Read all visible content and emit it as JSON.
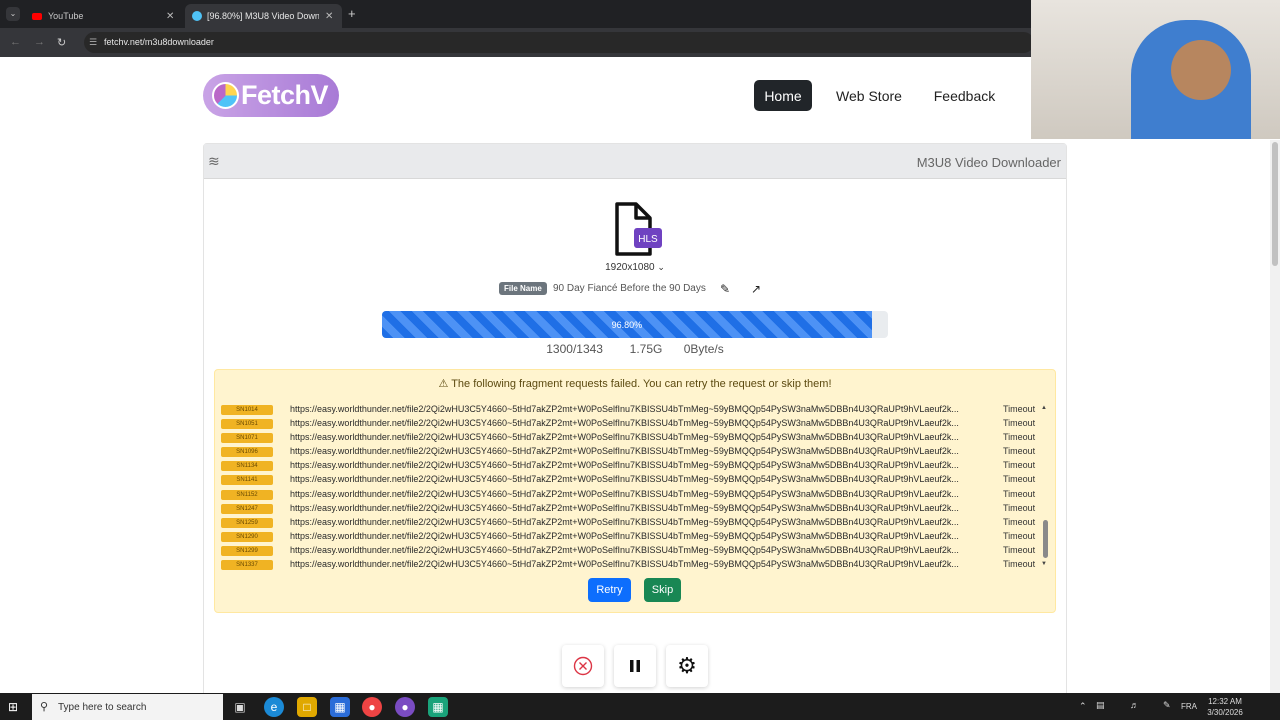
{
  "browser": {
    "tabs": [
      {
        "title": "YouTube",
        "active": false
      },
      {
        "title": "[96.80%] M3U8 Video Downlo",
        "active": true
      }
    ],
    "url": "fetchv.net/m3u8downloader"
  },
  "header": {
    "logo_text": "FetchV",
    "nav": [
      {
        "label": "Home",
        "active": true
      },
      {
        "label": "Web Store",
        "active": false
      },
      {
        "label": "Feedback",
        "active": false
      }
    ]
  },
  "card": {
    "title": "M3U8 Video Downloader",
    "file_type_badge": "HLS",
    "resolution": "1920x1080",
    "filename_label": "File Name",
    "filename": "90 Day Fiancé Before the 90 Days"
  },
  "progress": {
    "percent_label": "96.80%",
    "fraction": 0.968,
    "segments": "1300/1343",
    "size": "1.75G",
    "speed": "0Byte/s"
  },
  "alert": {
    "message": "The following fragment requests failed. You can retry the request or skip them!",
    "fragments": [
      {
        "id": "SN1014",
        "url": "https://easy.worldthunder.net/file2/2Qi2wHU3C5Y4660~5tHd7akZP2mt+W0PoSelfInu7KBISSU4bTmMeg~59yBMQQp54PySW3naMw5DBBn4U3QRaUPt9hVLaeuf2k...",
        "status": "Timeout"
      },
      {
        "id": "SN1051",
        "url": "https://easy.worldthunder.net/file2/2Qi2wHU3C5Y4660~5tHd7akZP2mt+W0PoSelfInu7KBISSU4bTmMeg~59yBMQQp54PySW3naMw5DBBn4U3QRaUPt9hVLaeuf2k...",
        "status": "Timeout"
      },
      {
        "id": "SN1071",
        "url": "https://easy.worldthunder.net/file2/2Qi2wHU3C5Y4660~5tHd7akZP2mt+W0PoSelfInu7KBISSU4bTmMeg~59yBMQQp54PySW3naMw5DBBn4U3QRaUPt9hVLaeuf2k...",
        "status": "Timeout"
      },
      {
        "id": "SN1096",
        "url": "https://easy.worldthunder.net/file2/2Qi2wHU3C5Y4660~5tHd7akZP2mt+W0PoSelfInu7KBISSU4bTmMeg~59yBMQQp54PySW3naMw5DBBn4U3QRaUPt9hVLaeuf2k...",
        "status": "Timeout"
      },
      {
        "id": "SN1134",
        "url": "https://easy.worldthunder.net/file2/2Qi2wHU3C5Y4660~5tHd7akZP2mt+W0PoSelfInu7KBISSU4bTmMeg~59yBMQQp54PySW3naMw5DBBn4U3QRaUPt9hVLaeuf2k...",
        "status": "Timeout"
      },
      {
        "id": "SN1141",
        "url": "https://easy.worldthunder.net/file2/2Qi2wHU3C5Y4660~5tHd7akZP2mt+W0PoSelfInu7KBISSU4bTmMeg~59yBMQQp54PySW3naMw5DBBn4U3QRaUPt9hVLaeuf2k...",
        "status": "Timeout"
      },
      {
        "id": "SN1152",
        "url": "https://easy.worldthunder.net/file2/2Qi2wHU3C5Y4660~5tHd7akZP2mt+W0PoSelfInu7KBISSU4bTmMeg~59yBMQQp54PySW3naMw5DBBn4U3QRaUPt9hVLaeuf2k...",
        "status": "Timeout"
      },
      {
        "id": "SN1247",
        "url": "https://easy.worldthunder.net/file2/2Qi2wHU3C5Y4660~5tHd7akZP2mt+W0PoSelfInu7KBISSU4bTmMeg~59yBMQQp54PySW3naMw5DBBn4U3QRaUPt9hVLaeuf2k...",
        "status": "Timeout"
      },
      {
        "id": "SN1259",
        "url": "https://easy.worldthunder.net/file2/2Qi2wHU3C5Y4660~5tHd7akZP2mt+W0PoSelfInu7KBISSU4bTmMeg~59yBMQQp54PySW3naMw5DBBn4U3QRaUPt9hVLaeuf2k...",
        "status": "Timeout"
      },
      {
        "id": "SN1290",
        "url": "https://easy.worldthunder.net/file2/2Qi2wHU3C5Y4660~5tHd7akZP2mt+W0PoSelfInu7KBISSU4bTmMeg~59yBMQQp54PySW3naMw5DBBn4U3QRaUPt9hVLaeuf2k...",
        "status": "Timeout"
      },
      {
        "id": "SN1299",
        "url": "https://easy.worldthunder.net/file2/2Qi2wHU3C5Y4660~5tHd7akZP2mt+W0PoSelfInu7KBISSU4bTmMeg~59yBMQQp54PySW3naMw5DBBn4U3QRaUPt9hVLaeuf2k...",
        "status": "Timeout"
      },
      {
        "id": "SN1337",
        "url": "https://easy.worldthunder.net/file2/2Qi2wHU3C5Y4660~5tHd7akZP2mt+W0PoSelfInu7KBISSU4bTmMeg~59yBMQQp54PySW3naMw5DBBn4U3QRaUPt9hVLaeuf2k...",
        "status": "Timeout"
      }
    ],
    "retry_label": "Retry",
    "skip_label": "Skip"
  },
  "controls": {
    "icons": [
      "cancel-icon",
      "pause-icon",
      "gear-icon"
    ]
  },
  "taskbar": {
    "search_placeholder": "Type here to search",
    "language": "FRA",
    "time": "12:32 AM",
    "date": "3/30/2026"
  },
  "colors": {
    "primary": "#0d6efd",
    "success": "#198754",
    "warning_bg": "#fff4cf",
    "badge": "#f0b323",
    "hls_purple": "#6f42c1"
  }
}
